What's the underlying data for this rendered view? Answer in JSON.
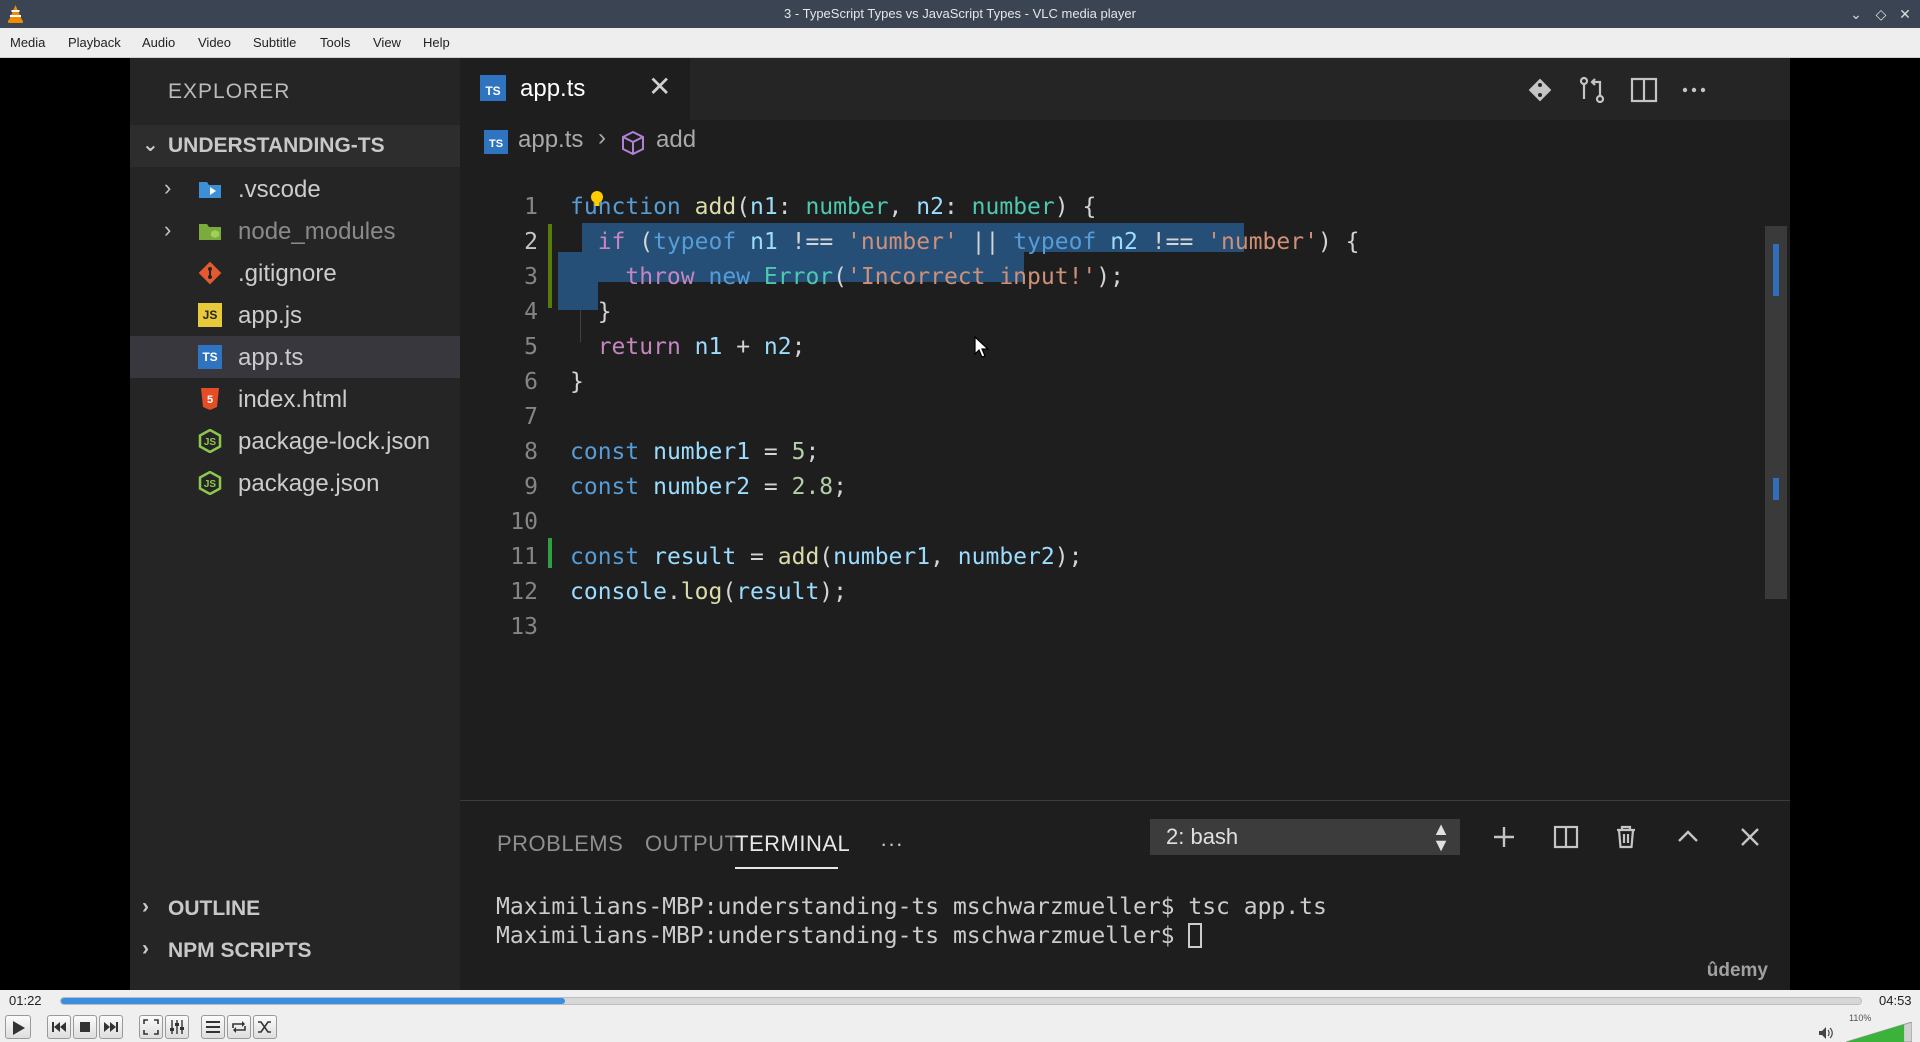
{
  "window": {
    "title": "3 - TypeScript Types vs JavaScript Types - VLC media player"
  },
  "menu": [
    "Media",
    "Playback",
    "Audio",
    "Video",
    "Subtitle",
    "Tools",
    "View",
    "Help"
  ],
  "explorer": {
    "title": "EXPLORER",
    "project": "UNDERSTANDING-TS",
    "folders": [
      ".vscode",
      "node_modules"
    ],
    "files": [
      ".gitignore",
      "app.js",
      "app.ts",
      "index.html",
      "package-lock.json",
      "package.json"
    ],
    "icons": {
      "js": "JS",
      "ts": "TS"
    },
    "outline": "OUTLINE",
    "npm_scripts": "NPM SCRIPTS"
  },
  "editor": {
    "tab": "app.ts",
    "breadcrumb": [
      "app.ts",
      "add"
    ],
    "line_numbers": [
      "1",
      "2",
      "3",
      "4",
      "5",
      "6",
      "7",
      "8",
      "9",
      "10",
      "11",
      "12",
      "13"
    ],
    "code": {
      "l1": {
        "kw": "function",
        "fn": "add",
        "p1": "n1",
        "t1": "number",
        "p2": "n2",
        "t2": "number"
      },
      "l2": {
        "if": "if",
        "typeof": "typeof",
        "n1": "n1",
        "op": "!==",
        "s": "'number'",
        "or": "||",
        "n2": "n2"
      },
      "l3": {
        "throw": "throw",
        "new": "new",
        "cls": "Error",
        "msg": "'Incorrect input!'"
      },
      "l5": {
        "ret": "return",
        "a": "n1",
        "b": "n2"
      },
      "l8": {
        "kw": "const",
        "name": "number1",
        "val": "5"
      },
      "l9": {
        "kw": "const",
        "name": "number2",
        "val": "2.8"
      },
      "l11": {
        "kw": "const",
        "name": "result",
        "fn": "add",
        "a": "number1",
        "b": "number2"
      },
      "l12": {
        "obj": "console",
        "fn": "log",
        "arg": "result"
      }
    }
  },
  "panel": {
    "tabs": [
      "PROBLEMS",
      "OUTPUT",
      "TERMINAL"
    ],
    "more": "···",
    "shell_select": "2: bash",
    "terminal_lines": [
      "Maximilians-MBP:understanding-ts mschwarzmueller$ tsc app.ts",
      "Maximilians-MBP:understanding-ts mschwarzmueller$ "
    ],
    "watermark": "ûdemy"
  },
  "player": {
    "elapsed": "01:22",
    "total": "04:53",
    "progress": 0.28,
    "volume_label": "110%",
    "volume": 1.1
  },
  "colors": {
    "vlc_accent": "#3b8de0",
    "vscode_bg": "#1e1e1e",
    "selection": "#264f78"
  }
}
